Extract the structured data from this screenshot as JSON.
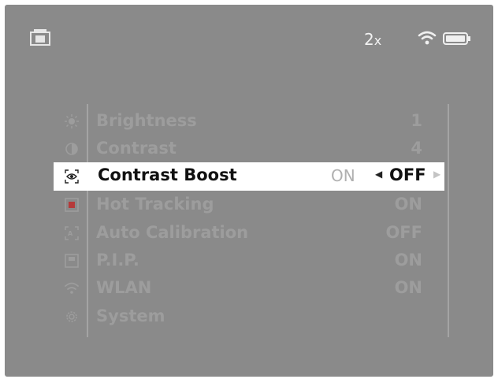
{
  "status_bar": {
    "zoom_value": "2",
    "zoom_unit": "x",
    "icons": [
      "camera-icon",
      "wifi-icon",
      "battery-icon"
    ]
  },
  "menu": {
    "items": [
      {
        "label": "Brightness",
        "value": "1",
        "icon": "sun-icon"
      },
      {
        "label": "Contrast",
        "value": "4",
        "icon": "contrast-icon"
      },
      {
        "label": "Contrast Boost",
        "options": [
          "ON",
          "OFF"
        ],
        "selected": "OFF",
        "icon": "eye-icon"
      },
      {
        "label": "Hot Tracking",
        "value": "ON",
        "icon": "hot-tracking-icon"
      },
      {
        "label": "Auto Calibration",
        "value": "OFF",
        "icon": "calibration-icon"
      },
      {
        "label": "P.I.P.",
        "value": "ON",
        "icon": "pip-icon"
      },
      {
        "label": "WLAN",
        "value": "ON",
        "icon": "wlan-icon"
      },
      {
        "label": "System",
        "icon": "gear-icon"
      }
    ]
  },
  "colors": {
    "screen_bg": "#8a8a8a",
    "inactive_text": "#9d9d9d",
    "active_bg": "#ffffff",
    "active_text": "#111111"
  }
}
